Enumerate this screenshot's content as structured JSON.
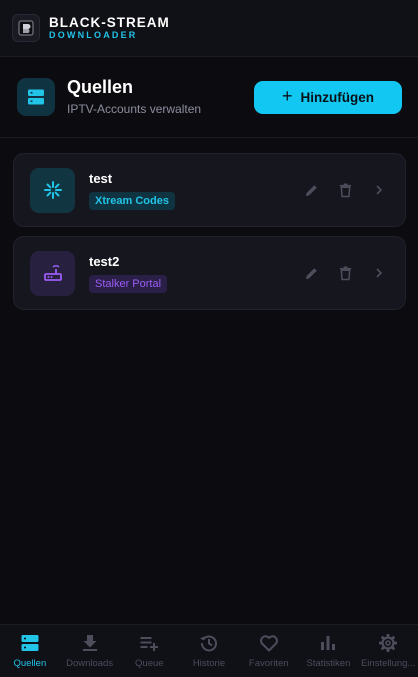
{
  "app": {
    "title": "BLACK-STREAM",
    "subtitle": "DOWNLOADER"
  },
  "header": {
    "title": "Quellen",
    "subtitle": "IPTV-Accounts verwalten",
    "add_label": "Hinzufügen",
    "add_icon": "plus-icon"
  },
  "sources": [
    {
      "name": "test",
      "type": "Xtream Codes",
      "icon": "xtream-icon",
      "color": "#22c4e8"
    },
    {
      "name": "test2",
      "type": "Stalker Portal",
      "icon": "router-icon",
      "color": "#9b5cf5"
    }
  ],
  "nav": [
    {
      "label": "Quellen",
      "icon": "server-icon",
      "active": true
    },
    {
      "label": "Downloads",
      "icon": "download-icon",
      "active": false
    },
    {
      "label": "Queue",
      "icon": "queue-icon",
      "active": false
    },
    {
      "label": "Historie",
      "icon": "history-icon",
      "active": false
    },
    {
      "label": "Favoriten",
      "icon": "heart-icon",
      "active": false
    },
    {
      "label": "Statistiken",
      "icon": "chart-icon",
      "active": false
    },
    {
      "label": "Einstellung...",
      "icon": "gear-icon",
      "active": false
    }
  ],
  "colors": {
    "accent": "#12c8f2",
    "accent_text": "#22c4e8",
    "stalker": "#9b5cf5",
    "background": "#0b0b10",
    "card": "#16161f"
  }
}
